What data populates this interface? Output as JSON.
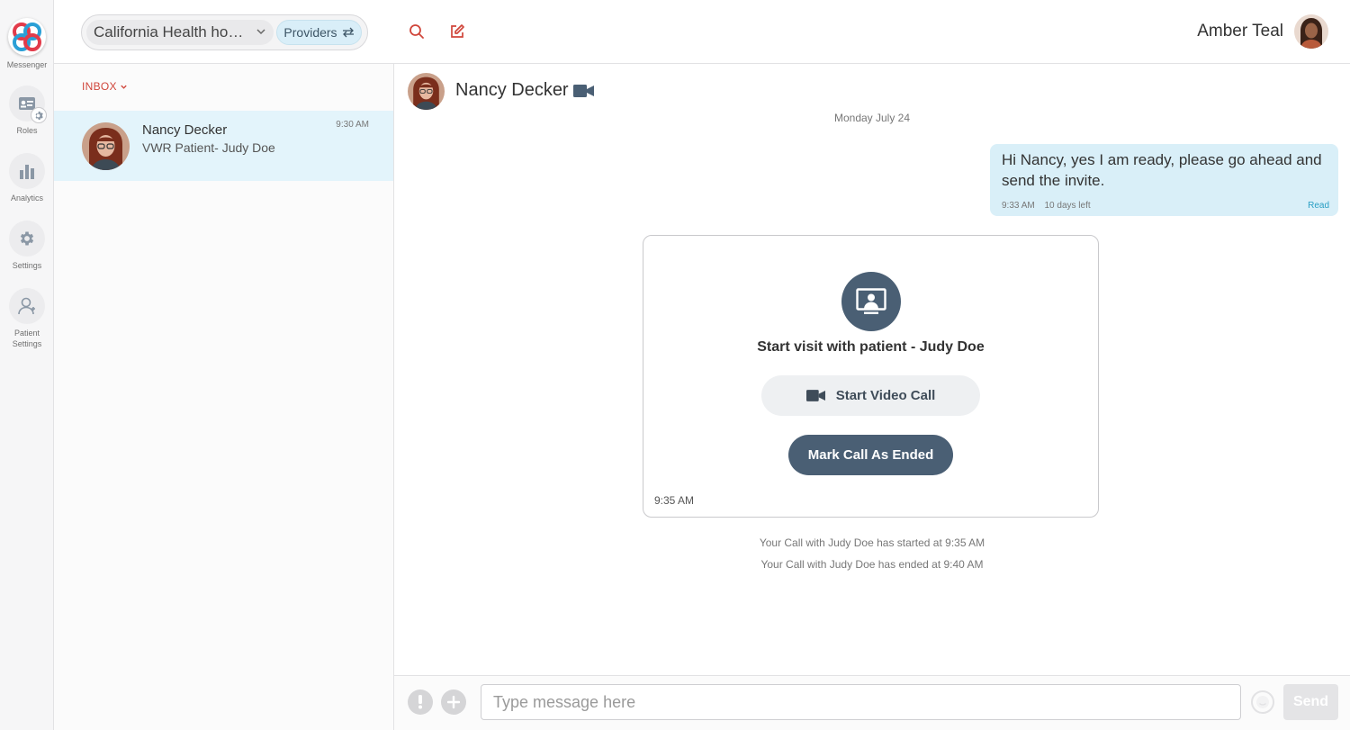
{
  "rail": {
    "logo_label": "Messenger",
    "items": [
      {
        "label": "Roles"
      },
      {
        "label": "Analytics"
      },
      {
        "label": "Settings"
      },
      {
        "label": "Patient Settings"
      }
    ]
  },
  "topbar": {
    "org_name": "California Health hospital",
    "providers_label": "Providers",
    "user_name": "Amber Teal"
  },
  "inbox": {
    "label": "INBOX",
    "conversations": [
      {
        "name": "Nancy Decker",
        "subtitle": "VWR Patient- Judy Doe",
        "time": "9:30 AM"
      }
    ]
  },
  "chat": {
    "contact_name": "Nancy Decker",
    "date_separator": "Monday July 24",
    "outgoing": {
      "text": "Hi Nancy, yes I am ready, please go ahead and send the invite.",
      "time": "9:33 AM",
      "expiry": "10 days left",
      "status": "Read"
    },
    "visit_card": {
      "title": "Start visit with patient - Judy Doe",
      "start_button": "Start Video Call",
      "end_button": "Mark Call As Ended",
      "time": "9:35 AM"
    },
    "system_messages": [
      "Your Call with Judy Doe has started at 9:35 AM",
      "Your Call with Judy Doe has ended at 9:40 AM"
    ]
  },
  "composer": {
    "placeholder": "Type message here",
    "send_label": "Send"
  },
  "colors": {
    "accent_red": "#d0463b",
    "selected_bg": "#e3f4fb",
    "bubble_bg": "#d9eff8",
    "slate": "#4a5f74",
    "read_status": "#2a9fc4"
  }
}
